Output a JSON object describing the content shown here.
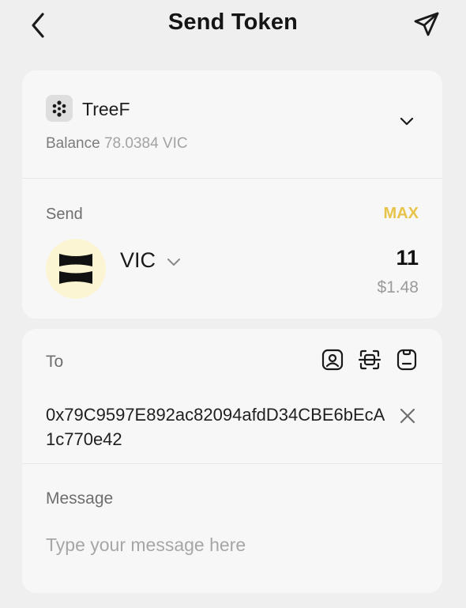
{
  "header": {
    "title": "Send Token",
    "back_icon": "chevron-left-icon",
    "send_icon": "paper-plane-icon"
  },
  "wallet": {
    "name": "TreeF",
    "balance_label": "Balance",
    "balance_value": "78.0384 VIC",
    "icon": "wallet-dots-icon"
  },
  "send": {
    "label": "Send",
    "max_label": "MAX",
    "token_symbol": "VIC",
    "amount": "11",
    "fiat_value": "$1.48"
  },
  "to": {
    "label": "To",
    "address": "0x79C9597E892ac82094afdD34CBE6bEcA1c770e42",
    "tools": [
      "address-book-icon",
      "scan-qr-icon",
      "clipboard-icon"
    ]
  },
  "message": {
    "label": "Message",
    "placeholder": "Type your message here"
  },
  "colors": {
    "background": "#efefef",
    "card": "#f7f7f7",
    "accent_max": "#e8c34a",
    "token_logo_bg": "#fbf5d3"
  }
}
